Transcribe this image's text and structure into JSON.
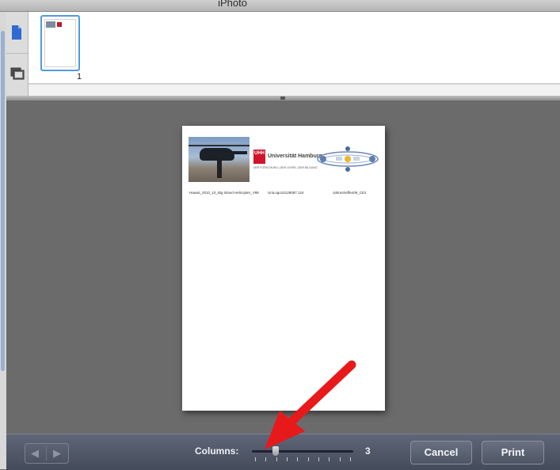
{
  "window": {
    "title": "iPhoto"
  },
  "thumbnails": [
    {
      "number": "1"
    }
  ],
  "page_preview": {
    "captions": [
      "Hawaii_2010_10_Big Island Helicopter_V88",
      "UniLogo10128087.124",
      "Jahrestreffen09_CE2"
    ],
    "logo_university": "Universität Hamburg",
    "logo_university_sub": "DER FORSCHUNG | DER LEHRE | DER BILDUNG",
    "logo_uhh": "UHH"
  },
  "toolbar": {
    "columns_label": "Columns:",
    "columns_value": "3",
    "columns_slider_level": 3,
    "columns_slider_range": [
      1,
      10
    ],
    "cancel_label": "Cancel",
    "print_label": "Print"
  },
  "colors": {
    "selection": "#4f9be0",
    "toolbar": "#4e5565",
    "annotation_arrow": "#e8191b"
  }
}
